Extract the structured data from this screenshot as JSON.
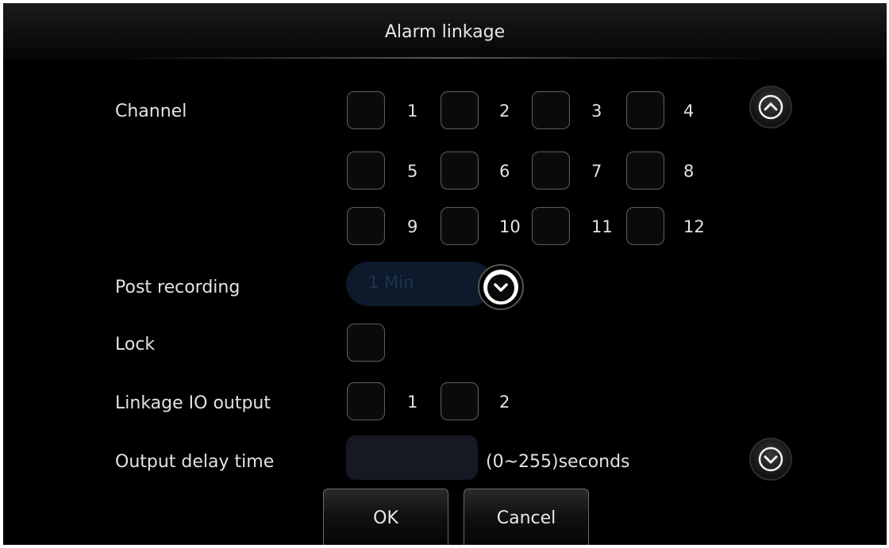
{
  "dialog": {
    "title": "Alarm linkage"
  },
  "labels": {
    "channel": "Channel",
    "post_recording": "Post recording",
    "lock": "Lock",
    "linkage_io_output": "Linkage IO output",
    "output_delay_time": "Output delay time"
  },
  "channels": [
    "1",
    "2",
    "3",
    "4",
    "5",
    "6",
    "7",
    "8",
    "9",
    "10",
    "11",
    "12"
  ],
  "post_recording": {
    "value": "1 Min"
  },
  "io_outputs": [
    "1",
    "2"
  ],
  "output_delay": {
    "value": "",
    "unit": "(0~255)seconds"
  },
  "buttons": {
    "ok": "OK",
    "cancel": "Cancel"
  },
  "icons": {
    "scroll_up": "chevron-up-icon",
    "scroll_down": "chevron-down-icon",
    "dropdown": "chevron-down-icon"
  },
  "colors": {
    "background": "#000000",
    "select_fill": "#0c1a2c",
    "input_fill": "#161823"
  }
}
